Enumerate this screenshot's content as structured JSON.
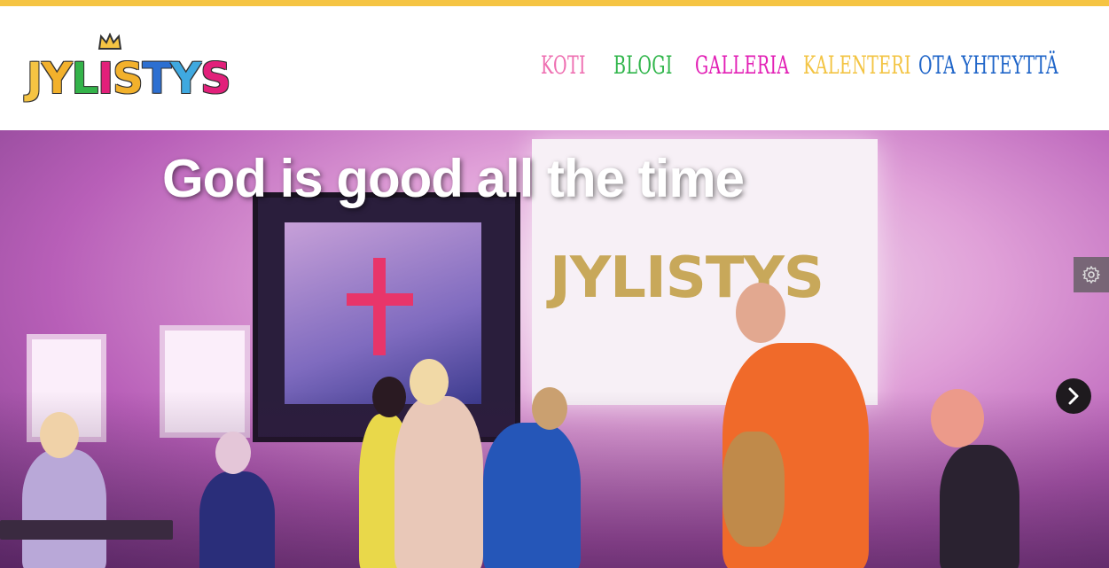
{
  "site": {
    "logo_text": "JYLISTYS",
    "logo_letters": [
      {
        "char": "J",
        "color": "#f5c443"
      },
      {
        "char": "Y",
        "color": "#f2b12c"
      },
      {
        "char": "L",
        "color": "#34b34a"
      },
      {
        "char": "I",
        "color": "#e2207a"
      },
      {
        "char": "S",
        "color": "#f2b12c"
      },
      {
        "char": "T",
        "color": "#2c6fd1"
      },
      {
        "char": "Y",
        "color": "#3fa9e0"
      },
      {
        "char": "S",
        "color": "#e2207a"
      }
    ],
    "top_bar_color": "#f5c443"
  },
  "nav": [
    {
      "label": "KOTI",
      "color": "#ee6fb1"
    },
    {
      "label": "BLOGI",
      "color": "#2fb54a"
    },
    {
      "label": "GALLERIA",
      "color": "#e21fb5"
    },
    {
      "label": "KALENTERI",
      "color": "#f3c443"
    },
    {
      "label": "OTA YHTEYTTÄ",
      "color": "#1e64c8"
    }
  ],
  "hero": {
    "title": "God is good all the time",
    "screen_logo": "JYLISTYS",
    "settings_icon": "gear-icon",
    "next_icon": "chevron-right-icon"
  }
}
